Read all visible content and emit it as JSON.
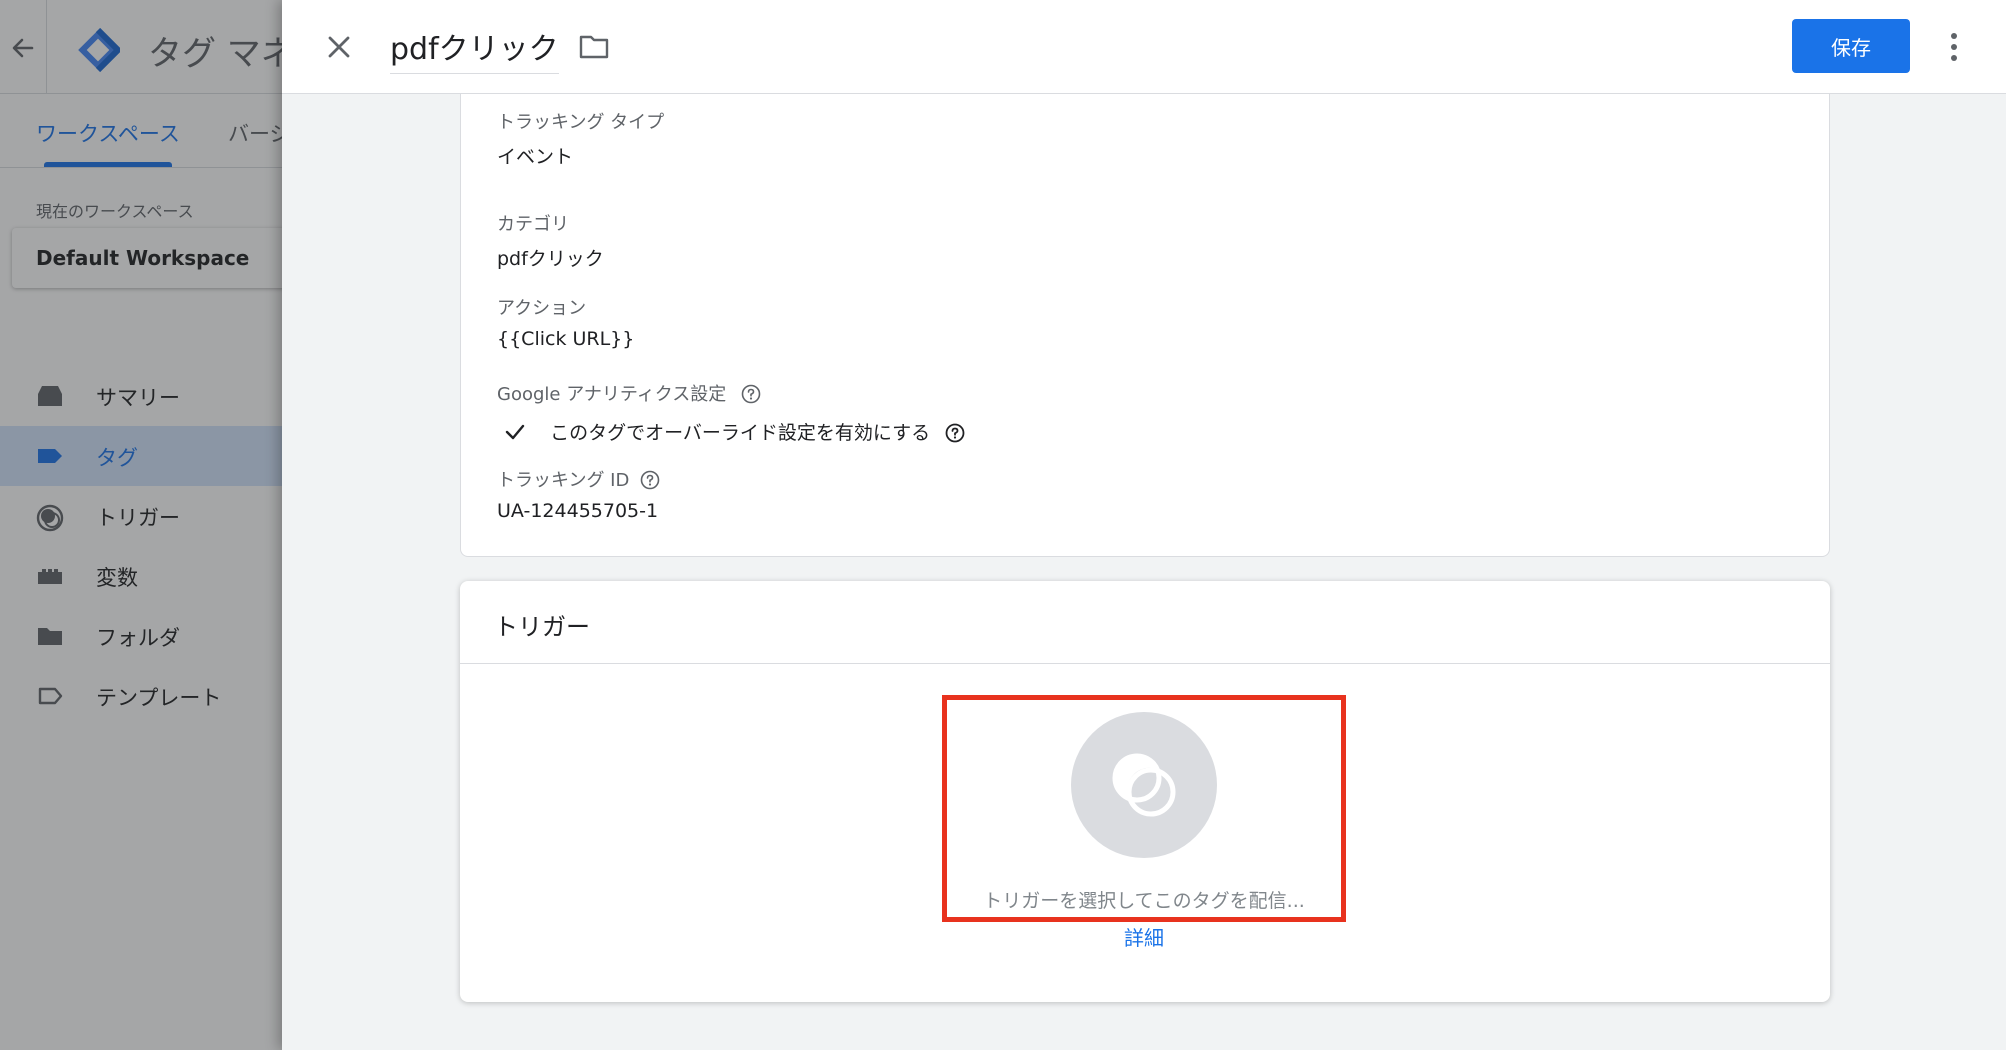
{
  "background": {
    "app_title": "タグ マネ",
    "tabs": [
      {
        "label": "ワークスペース"
      },
      {
        "label": "バージ"
      }
    ],
    "workspace_label": "現在のワークスペース",
    "workspace_name": "Default Workspace",
    "nav": [
      {
        "label": "サマリー",
        "icon": "summary-icon"
      },
      {
        "label": "タグ",
        "icon": "tag-icon"
      },
      {
        "label": "トリガー",
        "icon": "trigger-icon"
      },
      {
        "label": "変数",
        "icon": "variable-icon"
      },
      {
        "label": "フォルダ",
        "icon": "folder-icon"
      },
      {
        "label": "テンプレート",
        "icon": "template-icon"
      }
    ]
  },
  "sheet": {
    "tag_name": "pdfクリック",
    "save_label": "保存"
  },
  "config": {
    "tracking_type": {
      "label": "トラッキング タイプ",
      "value": "イベント"
    },
    "category": {
      "label": "カテゴリ",
      "value": "pdfクリック"
    },
    "action": {
      "label": "アクション",
      "value": "{{Click URL}}"
    },
    "ga_settings_label": "Google アナリティクス設定",
    "override_text": "このタグでオーバーライド設定を有効にする",
    "tracking_id": {
      "label": "トラッキング ID",
      "value": "UA-124455705-1"
    }
  },
  "trigger": {
    "title": "トリガー",
    "placeholder": "トリガーを選択してこのタグを配信...",
    "details_link": "詳細"
  },
  "colors": {
    "accent": "#1a73e8",
    "highlight": "#e8321e"
  }
}
